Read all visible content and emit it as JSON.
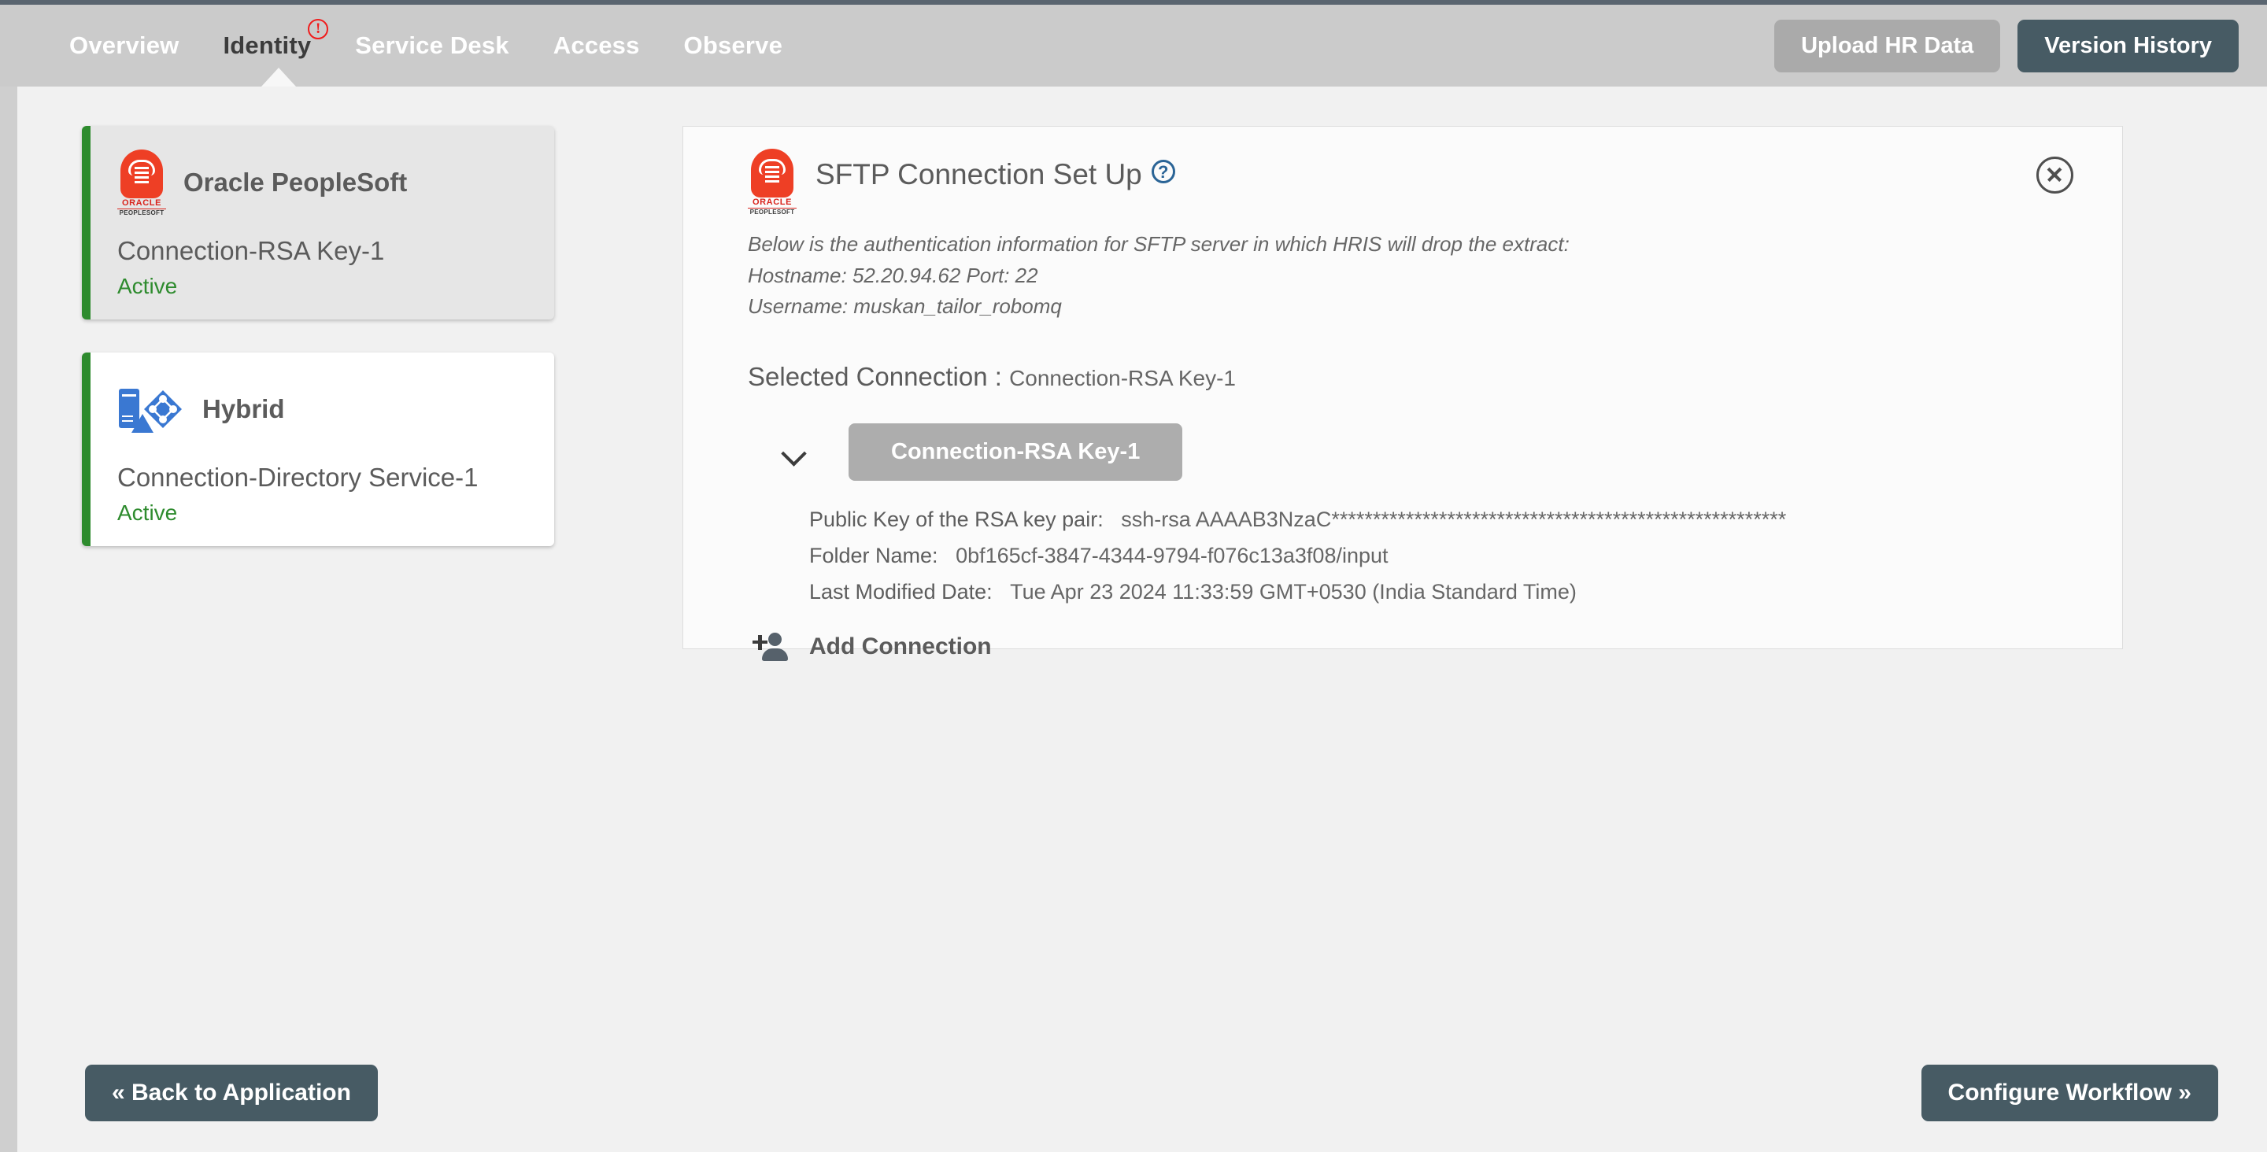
{
  "nav": {
    "items": [
      {
        "label": "Overview",
        "active": false,
        "warning": false
      },
      {
        "label": "Identity",
        "active": true,
        "warning": true,
        "warning_glyph": "!"
      },
      {
        "label": "Service Desk",
        "active": false,
        "warning": false
      },
      {
        "label": "Access",
        "active": false,
        "warning": false
      },
      {
        "label": "Observe",
        "active": false,
        "warning": false
      }
    ],
    "upload_label": "Upload HR Data",
    "version_label": "Version History"
  },
  "connections": [
    {
      "title": "Oracle PeopleSoft",
      "subtitle": "Connection-RSA Key-1",
      "status": "Active",
      "icon": "oracle-peoplesoft-logo",
      "selected": true,
      "logo_word": "ORACLE",
      "logo_word2": "PEOPLESOFT"
    },
    {
      "title": "Hybrid",
      "subtitle": "Connection-Directory Service-1",
      "status": "Active",
      "icon": "hybrid-directory-icon",
      "selected": false
    }
  ],
  "panel": {
    "title": "SFTP Connection Set Up",
    "help_glyph": "?",
    "intro": "Below is the authentication information for SFTP server in which HRIS will drop the extract:",
    "hostname_line": "Hostname: 52.20.94.62    Port: 22",
    "username_line": "Username: muskan_tailor_robomq",
    "selected_connection_label": "Selected Connection :",
    "selected_connection_value": "Connection-RSA Key-1",
    "connection_pill_label": "Connection-RSA Key-1",
    "details": {
      "public_key_label": "Public Key of the RSA key pair:",
      "public_key_value": "ssh-rsa AAAAB3NzaC*******************************************************",
      "folder_label": "Folder Name:",
      "folder_value": "0bf165cf-3847-4344-9794-f076c13a3f08/input",
      "modified_label": "Last Modified Date:",
      "modified_value": "Tue Apr 23 2024 11:33:59 GMT+0530 (India Standard Time)"
    },
    "add_connection_label": "Add Connection"
  },
  "footer": {
    "back_label": "« Back to Application",
    "configure_label": "Configure Workflow »"
  },
  "colors": {
    "accent_dark": "#475b64",
    "status_green": "#2e8b2e",
    "warning_red": "#f01c1c",
    "help_blue": "#2a6496",
    "oracle_red": "#ee3f25",
    "azure_blue": "#3a78d2"
  }
}
